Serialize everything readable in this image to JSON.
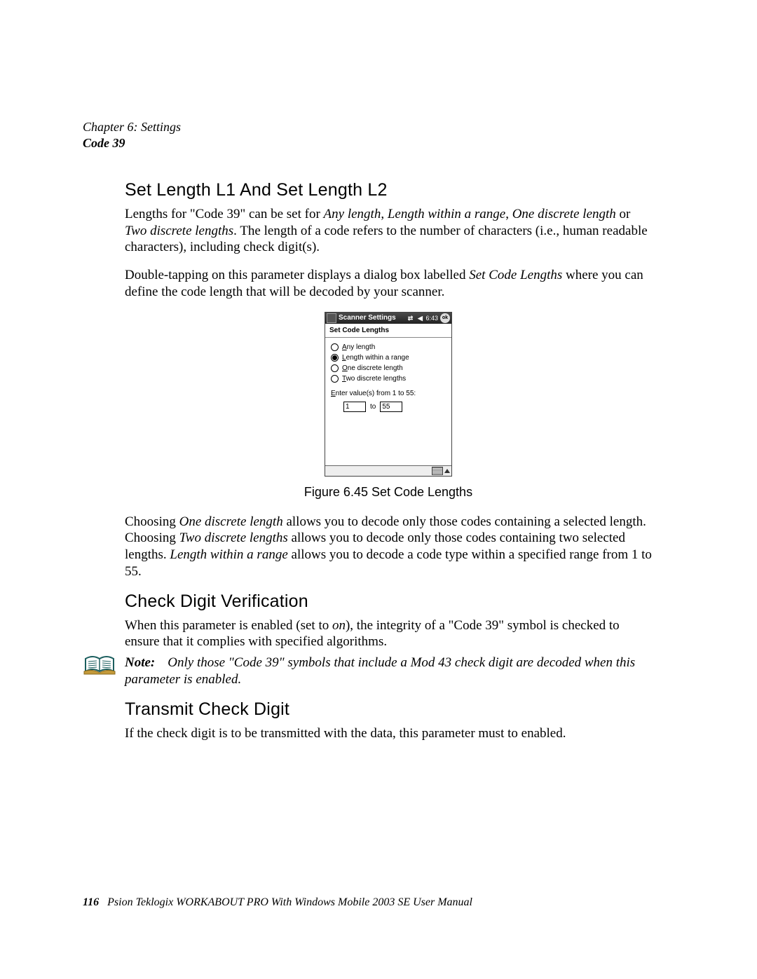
{
  "header": {
    "chapter": "Chapter 6: Settings",
    "section": "Code 39"
  },
  "section1": {
    "title": "Set Length L1 And Set Length L2",
    "p1_a": "Lengths for \"Code 39\" can be set for ",
    "p1_b": "Any length",
    "p1_c": ", ",
    "p1_d": "Length within a range",
    "p1_e": ", ",
    "p1_f": "One discrete length",
    "p1_g": " or ",
    "p1_h": "Two discrete lengths",
    "p1_i": ". The length of a code refers to the number of characters (i.e., human readable characters), including check digit(s).",
    "p2_a": "Double-tapping on this parameter displays a dialog box labelled ",
    "p2_b": "Set Code Lengths",
    "p2_c": " where you can define the code length that will be decoded by your scanner."
  },
  "dialog": {
    "title": "Scanner Settings",
    "time": "6:43",
    "ok": "ok",
    "subtitle": "Set Code Lengths",
    "opt_any": "Any length",
    "opt_range": "Length within a range",
    "opt_one": "One discrete length",
    "opt_two": "Two discrete lengths",
    "prompt": "Enter value(s) from 1 to 55:",
    "val1": "1",
    "to": "to",
    "val2": "55"
  },
  "figure_caption": "Figure 6.45 Set Code Lengths",
  "section1b": {
    "p3_a": "Choosing ",
    "p3_b": "One discrete length",
    "p3_c": " allows you to decode only those codes containing a selected length. Choosing ",
    "p3_d": "Two discrete lengths",
    "p3_e": " allows you to decode only those codes containing two selected lengths. ",
    "p3_f": "Length within a range",
    "p3_g": " allows you to decode a code type within a specified range from 1 to 55."
  },
  "section2": {
    "title": "Check Digit Verification",
    "p1_a": "When this parameter is enabled (set to ",
    "p1_b": "on",
    "p1_c": "), the integrity of a \"Code 39\" symbol is checked to ensure that it complies with specified algorithms."
  },
  "note": {
    "label": "Note:",
    "text": "Only those \"Code 39\" symbols that include a Mod 43 check digit are decoded when this parameter is enabled."
  },
  "section3": {
    "title": "Transmit Check Digit",
    "p1": "If the check digit is to be transmitted with the data, this parameter must to enabled."
  },
  "footer": {
    "page": "116",
    "book": "Psion Teklogix WORKABOUT PRO With Windows Mobile 2003 SE User Manual"
  }
}
